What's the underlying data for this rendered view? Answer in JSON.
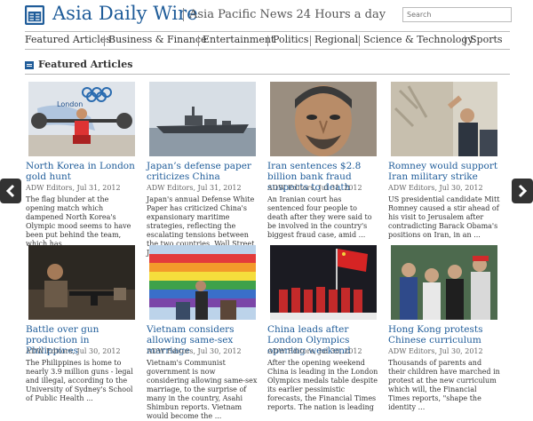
{
  "header": {
    "brand_asia": "Asia",
    "brand_rest": "Daily Wire",
    "tagline": "Asia Pacific News 24 Hours a day",
    "search_placeholder": "Search",
    "logo_icon": "newspaper-logo-icon"
  },
  "nav": [
    "Featured Articles",
    "Business & Finance",
    "Entertainment",
    "Politics",
    "Regional",
    "Science & Technology",
    "Sports"
  ],
  "section": {
    "title": "Featured Articles",
    "icon": "section-list-icon"
  },
  "articles": [
    {
      "title": "North Korea in London gold hunt",
      "meta": "ADW Editors, Jul 31, 2012",
      "summary": "The flag blunder at the opening match which dampened North Korea's Olympic mood seems to have been put behind the team, which has ..."
    },
    {
      "title": "Japan’s defense paper criticizes China",
      "meta": "ADW Editors, Jul 31, 2012",
      "summary": "Japan's annual Defense White Paper has criticized China's expansionary maritime strategies, reflecting the escalating tensions between the two countries, Wall Street Journal"
    },
    {
      "title": "Iran sentences $2.8 billion bank fraud suspects to death",
      "meta": "ADW Editors, Jul 31, 2012",
      "summary": "An Iranian court has sentenced four people to death after they were said to be involved in the country's biggest fraud case, amid ..."
    },
    {
      "title": "Romney would support Iran military strike",
      "meta": "ADW Editors, Jul 30, 2012",
      "summary": "US presidential candidate Mitt Romney caused a stir ahead of his visit to Jerusalem after contradicting Barack Obama's positions on Iran, in an ..."
    },
    {
      "title": "Battle over gun production in Philippines",
      "meta": "ADW Editors, Jul 30, 2012",
      "summary": "The Philippines is home to nearly 3.9 million guns - legal and illegal, according to the University of Sydney's School of Public Health ..."
    },
    {
      "title": "Vietnam considers allowing same-sex marriage",
      "meta": "ADW Editors, Jul 30, 2012",
      "summary": "Vietnam's Communist government is now considering allowing same-sex marriage, to the surprise of many in the country, Asahi Shimbun reports. Vietnam would become the ..."
    },
    {
      "title": "China leads after London Olympics opening weekend",
      "meta": "ADW Editors, Jul 30, 2012",
      "summary": "After the opening weekend China is leading in the London Olympics medals table despite its earlier pessimistic forecasts, the Financial Times reports. The nation is leading"
    },
    {
      "title": "Hong Kong protests Chinese curriculum",
      "meta": "ADW Editors, Jul 30, 2012",
      "summary": "Thousands of parents and their children have marched in protest at the new curriculum which will, the Financial Times reports, \"shape the identity ..."
    }
  ],
  "controls": {
    "prev_icon": "chevron-left-icon",
    "next_icon": "chevron-right-icon"
  },
  "colors": {
    "brand_blue": "#1f5c99",
    "link_blue": "#1f5c99",
    "arrow_bg": "#333333"
  }
}
